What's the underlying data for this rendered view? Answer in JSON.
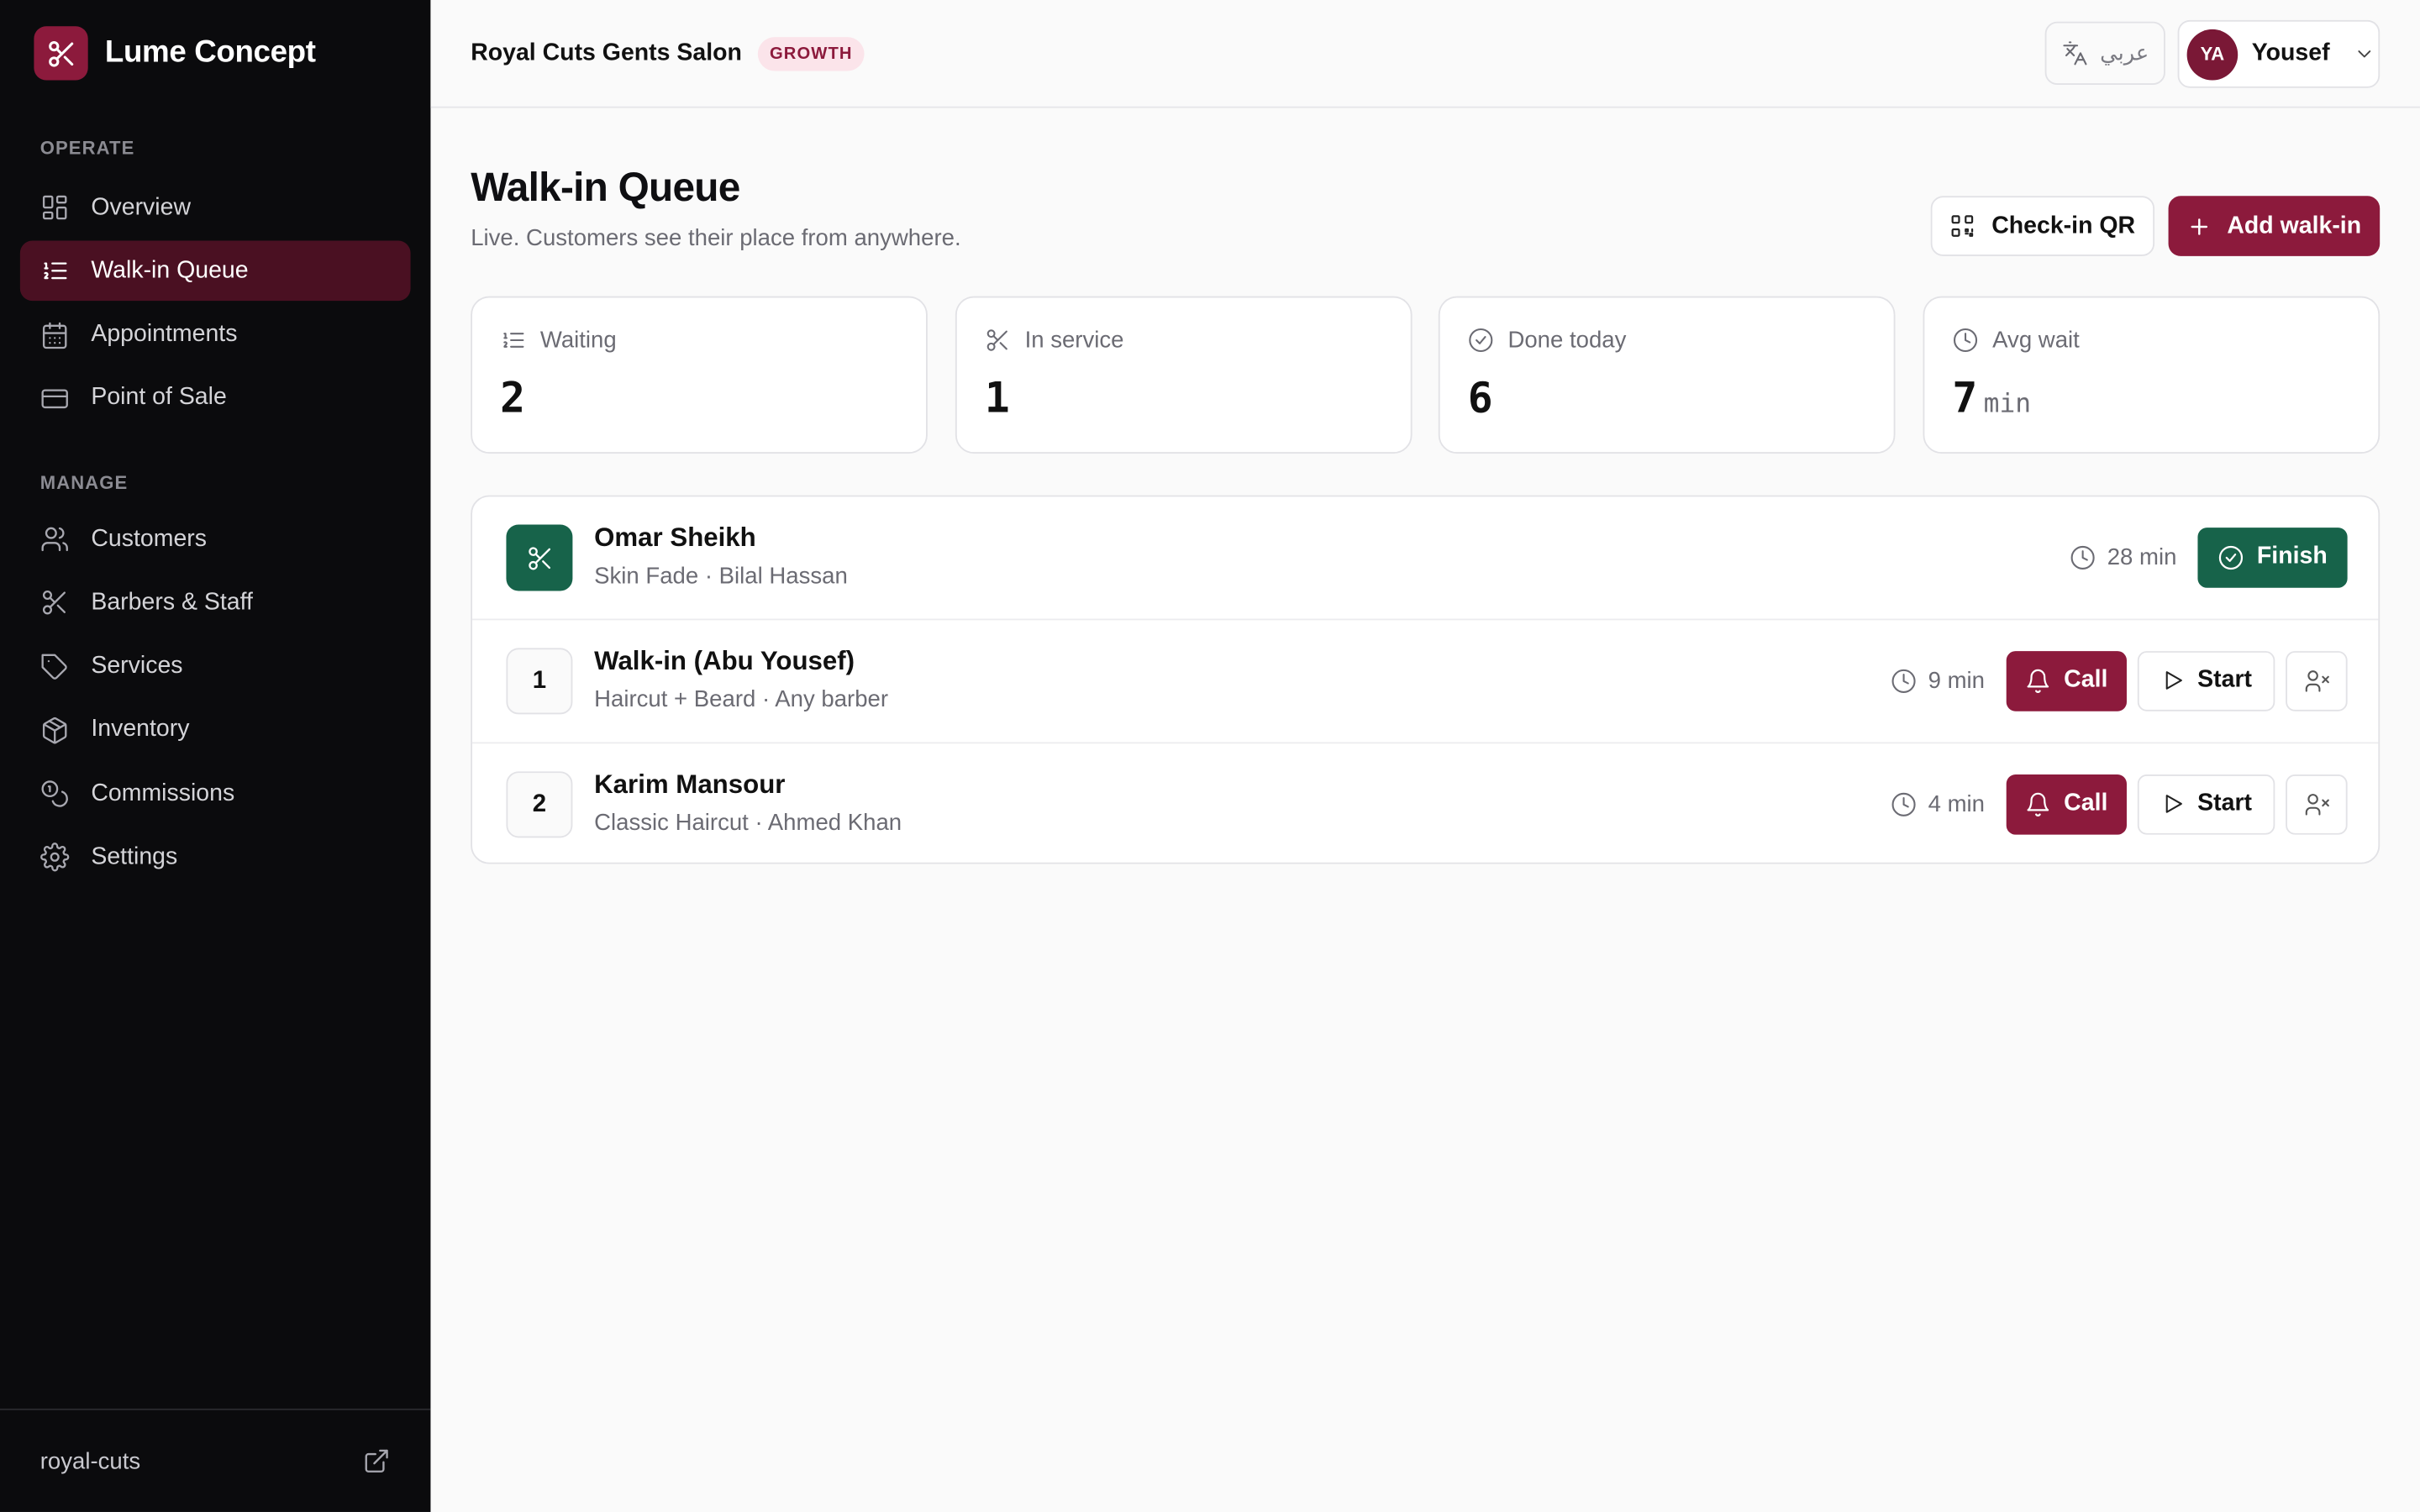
{
  "brand": {
    "name": "Lume Concept",
    "logo_icon": "scissors-icon",
    "logo_color": "#8c1a3c"
  },
  "sidebar": {
    "sections": [
      {
        "label": "OPERATE",
        "items": [
          {
            "label": "Overview",
            "icon": "grid-icon",
            "active": false
          },
          {
            "label": "Walk-in Queue",
            "icon": "list-ordered-icon",
            "active": true
          },
          {
            "label": "Appointments",
            "icon": "calendar-icon",
            "active": false
          },
          {
            "label": "Point of Sale",
            "icon": "credit-card-icon",
            "active": false
          }
        ]
      },
      {
        "label": "MANAGE",
        "items": [
          {
            "label": "Customers",
            "icon": "users-icon",
            "active": false
          },
          {
            "label": "Barbers & Staff",
            "icon": "scissors-icon",
            "active": false
          },
          {
            "label": "Services",
            "icon": "tag-icon",
            "active": false
          },
          {
            "label": "Inventory",
            "icon": "package-icon",
            "active": false
          },
          {
            "label": "Commissions",
            "icon": "coins-icon",
            "active": false
          },
          {
            "label": "Settings",
            "icon": "gear-icon",
            "active": false
          }
        ]
      }
    ],
    "footer": {
      "slug": "royal-cuts",
      "icon": "external-link-icon"
    }
  },
  "topbar": {
    "salon_name": "Royal Cuts Gents Salon",
    "plan_badge": "GROWTH",
    "language_label": "عربي",
    "user": {
      "initials": "YA",
      "name": "Yousef"
    }
  },
  "page": {
    "title": "Walk-in Queue",
    "subtitle": "Live. Customers see their place from anywhere.",
    "checkin_qr_label": "Check-in QR",
    "add_walkin_label": "Add walk-in"
  },
  "stats": [
    {
      "label": "Waiting",
      "value": "2",
      "unit": "",
      "icon": "list-ordered-icon"
    },
    {
      "label": "In service",
      "value": "1",
      "unit": "",
      "icon": "scissors-icon"
    },
    {
      "label": "Done today",
      "value": "6",
      "unit": "",
      "icon": "check-circle-icon"
    },
    {
      "label": "Avg wait",
      "value": "7",
      "unit": "min",
      "icon": "clock-icon"
    }
  ],
  "queue": [
    {
      "position": "",
      "status": "in-service",
      "name": "Omar Sheikh",
      "detail": "Skin Fade · Bilal Hassan",
      "wait": "28 min",
      "action": "Finish"
    },
    {
      "position": "1",
      "status": "waiting",
      "name": "Walk-in (Abu Yousef)",
      "detail": "Haircut + Beard · Any barber",
      "wait": "9 min",
      "call": "Call",
      "start": "Start"
    },
    {
      "position": "2",
      "status": "waiting",
      "name": "Karim Mansour",
      "detail": "Classic Haircut · Ahmed Khan",
      "wait": "4 min",
      "call": "Call",
      "start": "Start"
    }
  ],
  "colors": {
    "accent": "#8c1a3c",
    "success": "#17634a",
    "sidebar_bg": "#0b0b0d",
    "active_nav_bg": "#4a1022"
  }
}
